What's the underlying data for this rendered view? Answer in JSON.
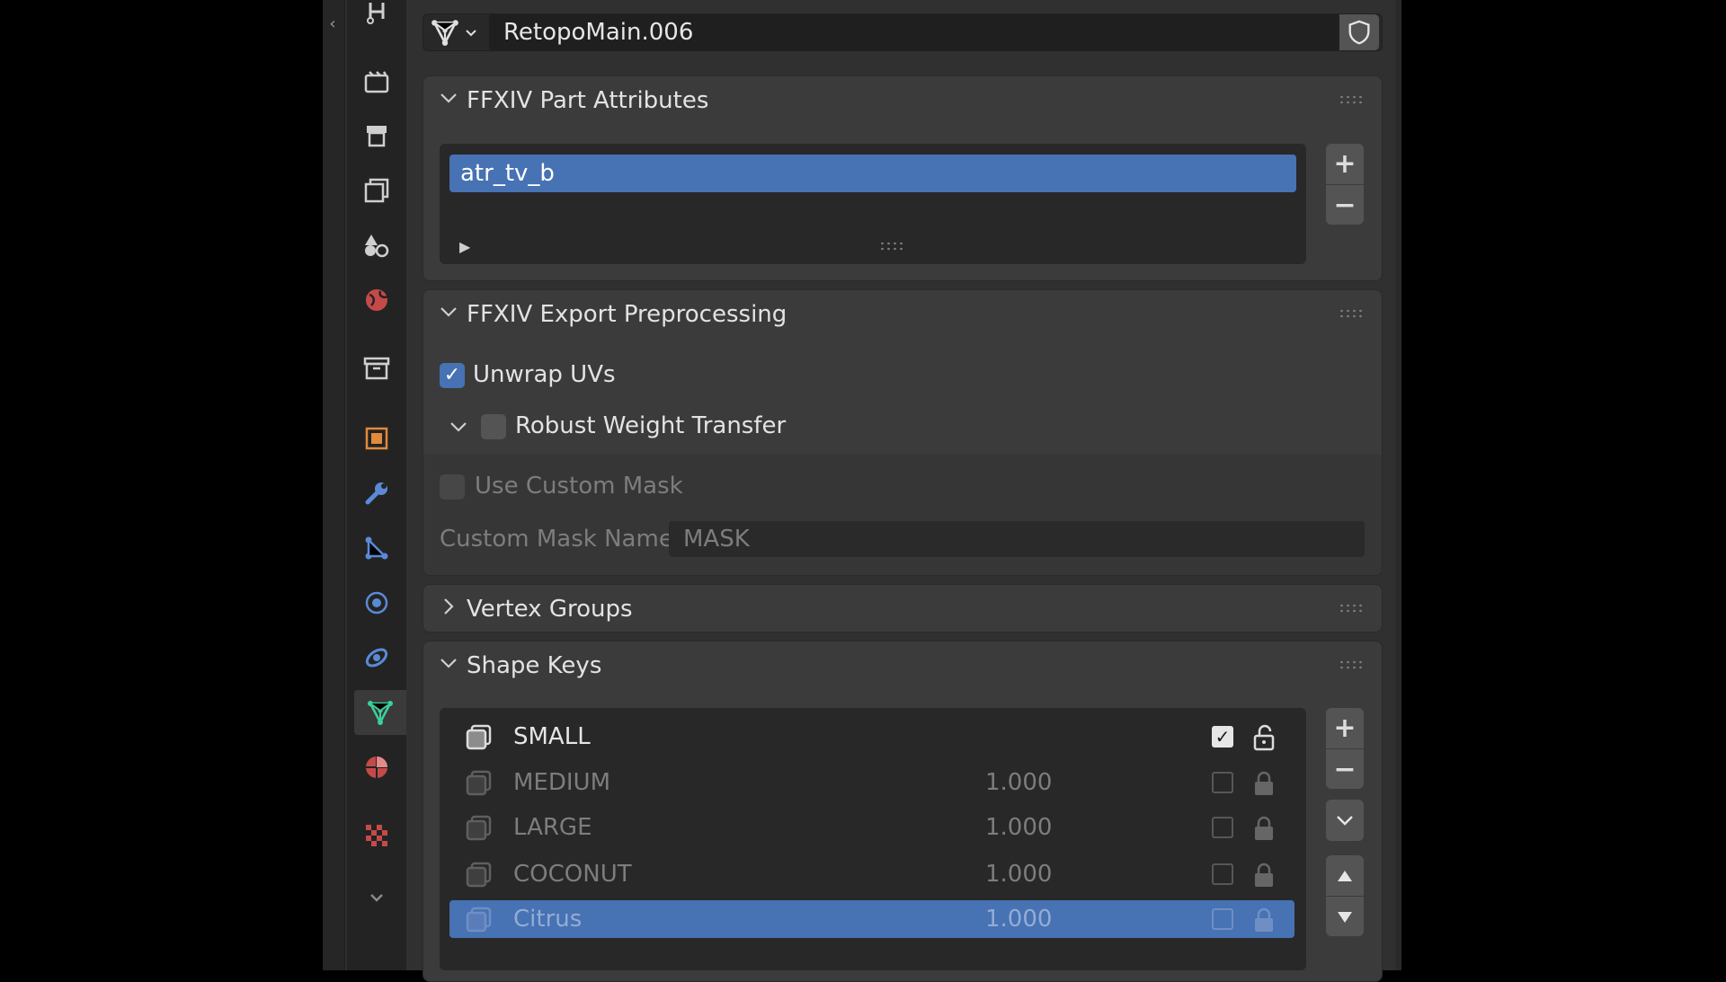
{
  "header": {
    "object_name": "RetopoMain.006"
  },
  "panels": {
    "part_attributes": {
      "title": "FFXIV Part Attributes",
      "items": [
        "atr_tv_b"
      ]
    },
    "export_preprocessing": {
      "title": "FFXIV Export Preprocessing",
      "unwrap_uvs_label": "Unwrap UVs",
      "unwrap_uvs_checked": true,
      "robust_weight_label": "Robust Weight Transfer",
      "robust_weight_checked": false,
      "use_custom_mask_label": "Use Custom Mask",
      "custom_mask_name_label": "Custom Mask Name:",
      "custom_mask_name_value": "MASK"
    },
    "vertex_groups": {
      "title": "Vertex Groups"
    },
    "shape_keys": {
      "title": "Shape Keys",
      "keys": [
        {
          "name": "SMALL",
          "value": "",
          "active": false,
          "checked": true
        },
        {
          "name": "MEDIUM",
          "value": "1.000",
          "active": false,
          "checked": false
        },
        {
          "name": "LARGE",
          "value": "1.000",
          "active": false,
          "checked": false
        },
        {
          "name": "COCONUT",
          "value": "1.000",
          "active": false,
          "checked": false
        },
        {
          "name": "Citrus",
          "value": "1.000",
          "active": true,
          "checked": false
        }
      ]
    }
  },
  "colors": {
    "accent": "#4772b3",
    "active_tab": "#3ad19a"
  },
  "icons": {
    "tabs": [
      "tool-icon",
      "render-icon",
      "output-icon",
      "view-layer-icon",
      "scene-icon",
      "world-icon",
      "collection-icon",
      "object-icon",
      "modifier-icon",
      "particles-icon",
      "physics-icon",
      "constraints-icon",
      "data-icon",
      "material-icon",
      "texture-icon",
      "more-icon"
    ]
  }
}
